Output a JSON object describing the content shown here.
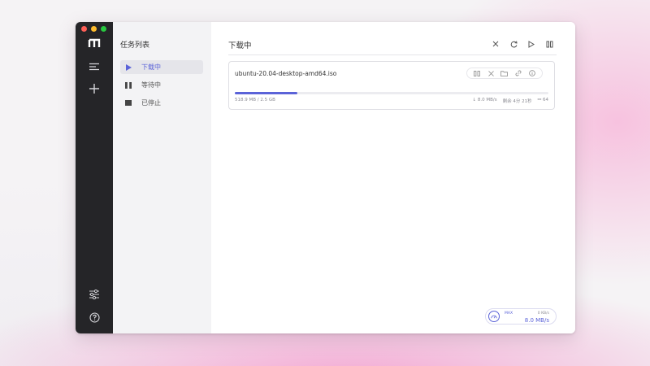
{
  "sidebar": {
    "icons": [
      "motrix-logo-icon",
      "menu-icon",
      "add-icon",
      "settings-sliders-icon",
      "help-icon"
    ]
  },
  "task_panel": {
    "title": "任务列表",
    "items": [
      {
        "label": "下载中",
        "icon": "play-icon",
        "active": true
      },
      {
        "label": "等待中",
        "icon": "pause-icon",
        "active": false
      },
      {
        "label": "已停止",
        "icon": "stop-icon",
        "active": false
      }
    ]
  },
  "main": {
    "title": "下载中",
    "toolbar": [
      "close-icon",
      "refresh-icon",
      "play-icon",
      "pause-icon"
    ]
  },
  "task": {
    "name": "ubuntu-20.04-desktop-amd64.iso",
    "size_progress": "518.9 MB / 2.5 GB",
    "progress_fraction": 0.2,
    "speed": "↓ 8.0 MB/s",
    "remaining": "剩余 4分 21秒",
    "connections": "⚯ 64",
    "actions": [
      "pause-icon",
      "delete-icon",
      "folder-icon",
      "link-icon",
      "info-icon"
    ]
  },
  "speedometer": {
    "max_label": "MAX",
    "upload": "0 KB/s",
    "download": "8.0 MB/s"
  },
  "colors": {
    "accent": "#5b63d8",
    "sidebar_dark": "#252528",
    "panel_bg": "#f3f3f5"
  }
}
